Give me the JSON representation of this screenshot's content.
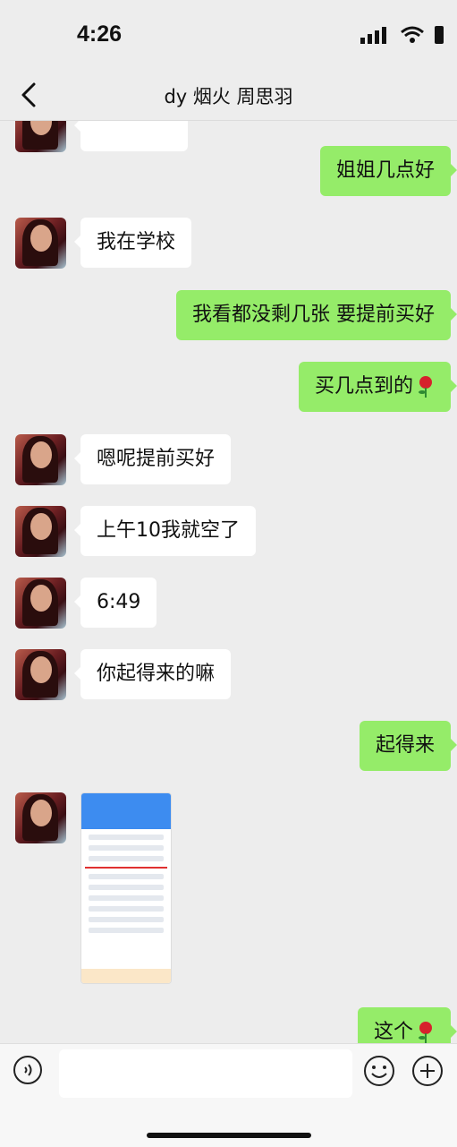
{
  "status_bar": {
    "time": "4:26"
  },
  "header": {
    "title": "dy 烟火 周思羽"
  },
  "messages": [
    {
      "side": "out",
      "text": "姐姐几点好"
    },
    {
      "side": "in",
      "text": "我在学校"
    },
    {
      "side": "out",
      "text": "我看都没剩几张 要提前买好"
    },
    {
      "side": "out",
      "text": "买几点到的",
      "emoji": "rose"
    },
    {
      "side": "in",
      "text": "嗯呢提前买好"
    },
    {
      "side": "in",
      "text": "上午10我就空了"
    },
    {
      "side": "in",
      "text": "6:49"
    },
    {
      "side": "in",
      "text": "你起得来的嘛"
    },
    {
      "side": "out",
      "text": "起得来"
    },
    {
      "side": "in",
      "type": "image"
    },
    {
      "side": "out",
      "text": "这个",
      "emoji": "rose"
    }
  ],
  "input_bar": {
    "placeholder": ""
  },
  "colors": {
    "background": "#ededed",
    "outgoing_bubble": "#95ec69",
    "incoming_bubble": "#ffffff"
  },
  "icons": [
    "back-chevron-icon",
    "signal-icon",
    "wifi-icon",
    "battery-icon",
    "voice-icon",
    "emoji-icon",
    "plus-icon"
  ]
}
